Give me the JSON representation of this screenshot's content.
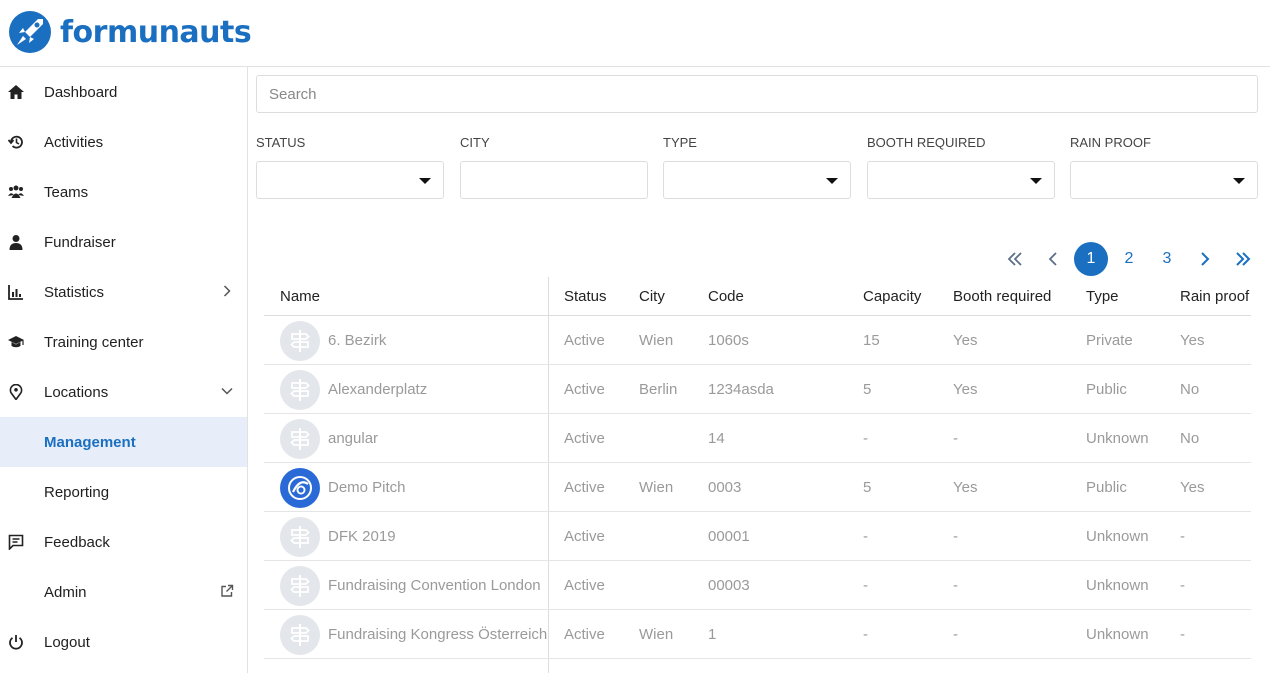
{
  "brand": {
    "name": "formunauts",
    "color": "#1a6fc0"
  },
  "sidebar": {
    "items": [
      {
        "label": "Dashboard",
        "icon": "home-icon"
      },
      {
        "label": "Activities",
        "icon": "history-icon"
      },
      {
        "label": "Teams",
        "icon": "group-icon"
      },
      {
        "label": "Fundraiser",
        "icon": "person-icon"
      },
      {
        "label": "Statistics",
        "icon": "chart-icon",
        "trail": "chevron-right-icon"
      },
      {
        "label": "Training center",
        "icon": "graduation-cap-icon"
      },
      {
        "label": "Locations",
        "icon": "location-pin-icon",
        "trail": "chevron-down-icon"
      },
      {
        "label": "Management",
        "active": true
      },
      {
        "label": "Reporting"
      },
      {
        "label": "Feedback",
        "icon": "feedback-icon"
      },
      {
        "label": "Admin",
        "trail": "external-link-icon"
      },
      {
        "label": "Logout",
        "icon": "power-icon"
      }
    ]
  },
  "search": {
    "placeholder": "Search",
    "value": ""
  },
  "filters": [
    {
      "label": "STATUS",
      "type": "select",
      "value": ""
    },
    {
      "label": "CITY",
      "type": "text",
      "value": ""
    },
    {
      "label": "TYPE",
      "type": "select",
      "value": ""
    },
    {
      "label": "BOOTH REQUIRED",
      "type": "select",
      "value": ""
    },
    {
      "label": "RAIN PROOF",
      "type": "select",
      "value": ""
    }
  ],
  "pagination": {
    "current": "1",
    "pages": [
      "1",
      "2",
      "3"
    ]
  },
  "table": {
    "columns": [
      "Name",
      "Status",
      "City",
      "Code",
      "Capacity",
      "Booth required",
      "Type",
      "Rain proof"
    ],
    "rows": [
      {
        "avatar": "signpost-icon",
        "name": "6. Bezirk",
        "status": "Active",
        "city": "Wien",
        "code": "1060s",
        "capacity": "15",
        "booth": "Yes",
        "type": "Private",
        "rain": "Yes"
      },
      {
        "avatar": "signpost-icon",
        "name": "Alexanderplatz",
        "status": "Active",
        "city": "Berlin",
        "code": "1234asda",
        "capacity": "5",
        "booth": "Yes",
        "type": "Public",
        "rain": "No"
      },
      {
        "avatar": "signpost-icon",
        "name": "angular",
        "status": "Active",
        "city": "",
        "code": "14",
        "capacity": "-",
        "booth": "-",
        "type": "Unknown",
        "rain": "No"
      },
      {
        "avatar": "astronaut-logo-icon",
        "name": "Demo Pitch",
        "status": "Active",
        "city": "Wien",
        "code": "0003",
        "capacity": "5",
        "booth": "Yes",
        "type": "Public",
        "rain": "Yes"
      },
      {
        "avatar": "signpost-icon",
        "name": "DFK 2019",
        "status": "Active",
        "city": "",
        "code": "00001",
        "capacity": "-",
        "booth": "-",
        "type": "Unknown",
        "rain": "-"
      },
      {
        "avatar": "signpost-icon",
        "name": "Fundraising Convention London",
        "status": "Active",
        "city": "",
        "code": "00003",
        "capacity": "-",
        "booth": "-",
        "type": "Unknown",
        "rain": "-"
      },
      {
        "avatar": "signpost-icon",
        "name": "Fundraising Kongress Österreich",
        "status": "Active",
        "city": "Wien",
        "code": "1",
        "capacity": "-",
        "booth": "-",
        "type": "Unknown",
        "rain": "-"
      }
    ]
  }
}
